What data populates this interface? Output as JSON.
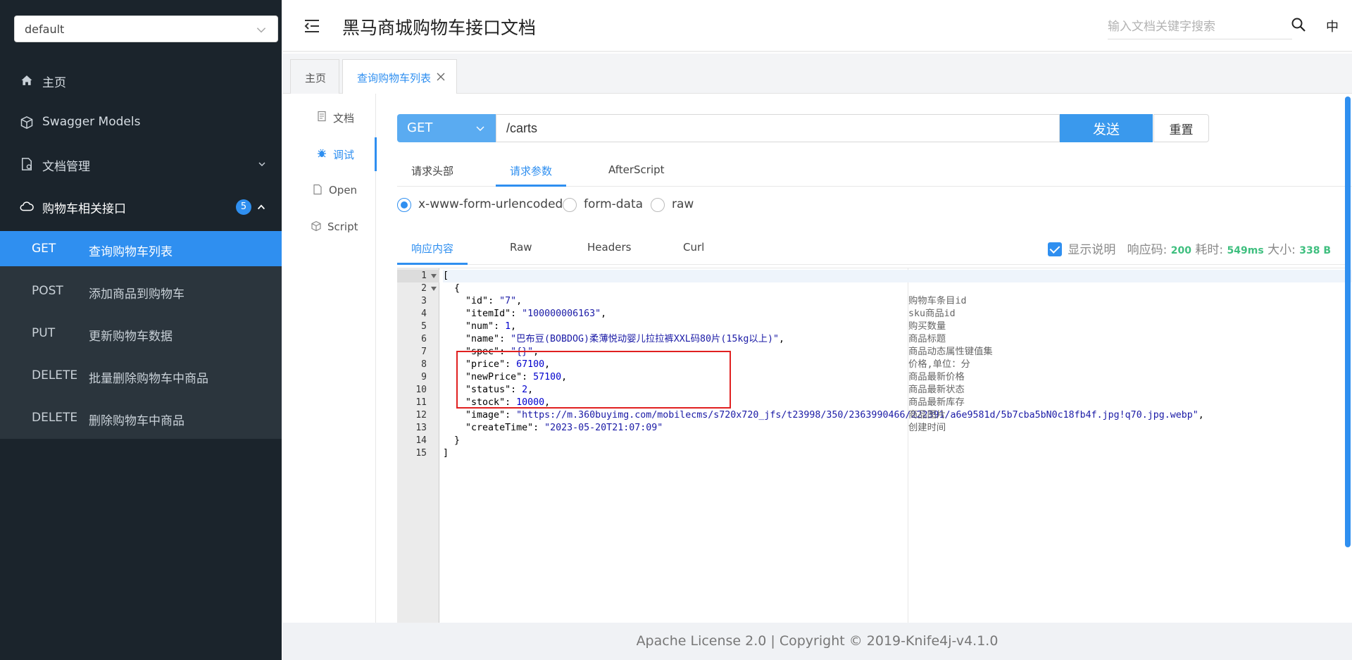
{
  "sidebar": {
    "group_select": "default",
    "menu": [
      {
        "label": "主页",
        "icon": "home-icon"
      },
      {
        "label": "Swagger Models",
        "icon": "cube-icon"
      },
      {
        "label": "文档管理",
        "icon": "doc-settings-icon"
      },
      {
        "label": "购物车相关接口",
        "icon": "cloud-icon",
        "badge": "5"
      }
    ],
    "apis": [
      {
        "method": "GET",
        "label": "查询购物车列表",
        "active": true
      },
      {
        "method": "POST",
        "label": "添加商品到购物车"
      },
      {
        "method": "PUT",
        "label": "更新购物车数据"
      },
      {
        "method": "DELETE",
        "label": "批量删除购物车中商品"
      },
      {
        "method": "DELETE",
        "label": "删除购物车中商品"
      }
    ]
  },
  "header": {
    "title": "黑马商城购物车接口文档",
    "search_placeholder": "输入文档关键字搜索",
    "lang": "中"
  },
  "tabs": [
    {
      "label": "主页"
    },
    {
      "label": "查询购物车列表",
      "active": true
    }
  ],
  "vtabs": [
    {
      "label": "文档",
      "icon": "document-icon"
    },
    {
      "label": "调试",
      "icon": "bug-icon",
      "active": true
    },
    {
      "label": "Open",
      "icon": "file-icon"
    },
    {
      "label": "Script",
      "icon": "script-icon"
    }
  ],
  "request": {
    "method": "GET",
    "url": "/carts",
    "send_label": "发送",
    "reset_label": "重置",
    "tabs": [
      "请求头部",
      "请求参数",
      "AfterScript"
    ],
    "body_types": [
      "x-www-form-urlencoded",
      "form-data",
      "raw"
    ]
  },
  "response": {
    "tabs": [
      "响应内容",
      "Raw",
      "Headers",
      "Curl"
    ],
    "show_desc_label": "显示说明",
    "status_label": "响应码:",
    "status_code": "200",
    "time_label": "耗时:",
    "time": "549ms",
    "size_label": "大小:",
    "size": "338 B",
    "line_numbers": [
      "1",
      "2",
      "3",
      "4",
      "5",
      "6",
      "7",
      "8",
      "9",
      "10",
      "11",
      "12",
      "13",
      "14",
      "15"
    ],
    "lines": [
      "[",
      "  {",
      "    \"id\": \"7\",",
      "    \"itemId\": \"100000006163\",",
      "    \"num\": 1,",
      "    \"name\": \"巴布豆(BOBDOG)柔薄悦动婴儿拉拉裤XXL码80片(15kg以上)\",",
      "    \"spec\": \"{}\",",
      "    \"price\": 67100,",
      "    \"newPrice\": 57100,",
      "    \"status\": 2,",
      "    \"stock\": 10000,",
      "    \"image\": \"https://m.360buyimg.com/mobilecms/s720x720_jfs/t23998/350/2363990466/222391/a6e9581d/5b7cba5bN0c18fb4f.jpg!q70.jpg.webp\",",
      "    \"createTime\": \"2023-05-20T21:07:09\"",
      "  }",
      "]"
    ],
    "descriptions": [
      {
        "line": 3,
        "text": "购物车条目id"
      },
      {
        "line": 4,
        "text": "sku商品id"
      },
      {
        "line": 5,
        "text": "购买数量"
      },
      {
        "line": 6,
        "text": "商品标题"
      },
      {
        "line": 7,
        "text": "商品动态属性键值集"
      },
      {
        "line": 8,
        "text": "价格,单位：分"
      },
      {
        "line": 9,
        "text": "商品最新价格"
      },
      {
        "line": 10,
        "text": "商品最新状态"
      },
      {
        "line": 11,
        "text": "商品最新库存"
      },
      {
        "line": 12,
        "text": "商品图片"
      },
      {
        "line": 13,
        "text": "创建时间"
      }
    ]
  },
  "footer": {
    "text": "Apache License 2.0 | Copyright © 2019-Knife4j-v4.1.0"
  },
  "colors": {
    "accent": "#2f8ff0",
    "sidebar_bg": "#1b242c",
    "success": "#3fbf7f",
    "highlight": "#e02020"
  }
}
